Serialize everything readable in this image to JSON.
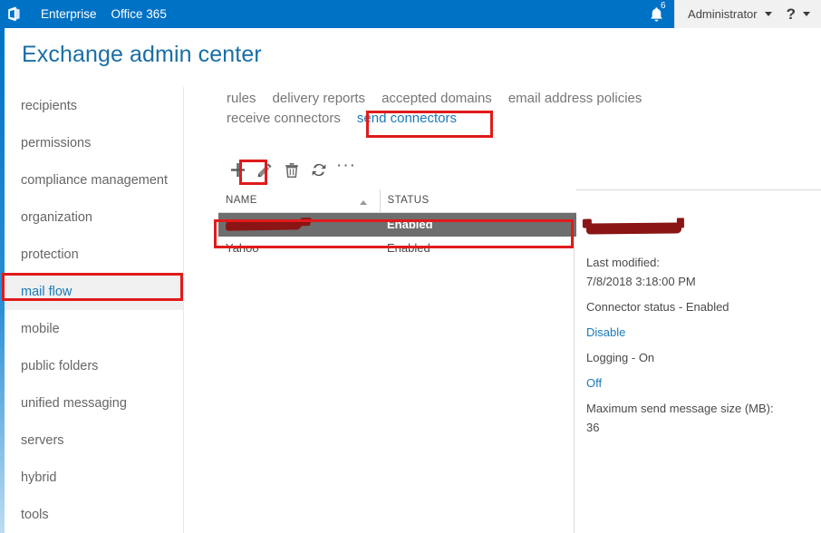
{
  "suite_bar": {
    "logo_icon": "office-logo-icon",
    "links": [
      {
        "label": "Enterprise"
      },
      {
        "label": "Office 365"
      }
    ],
    "notifications": {
      "icon": "bell-icon",
      "count": "6"
    },
    "account": {
      "name": "Administrator",
      "chevron_icon": "chevron-down-icon"
    },
    "help": {
      "label": "?",
      "chevron_icon": "chevron-down-icon"
    }
  },
  "page": {
    "title": "Exchange admin center"
  },
  "sidebar": {
    "items": [
      {
        "label": "recipients",
        "selected": false
      },
      {
        "label": "permissions",
        "selected": false
      },
      {
        "label": "compliance management",
        "selected": false
      },
      {
        "label": "organization",
        "selected": false
      },
      {
        "label": "protection",
        "selected": false
      },
      {
        "label": "mail flow",
        "selected": true
      },
      {
        "label": "mobile",
        "selected": false
      },
      {
        "label": "public folders",
        "selected": false
      },
      {
        "label": "unified messaging",
        "selected": false
      },
      {
        "label": "servers",
        "selected": false
      },
      {
        "label": "hybrid",
        "selected": false
      },
      {
        "label": "tools",
        "selected": false
      }
    ]
  },
  "tabs": [
    {
      "label": "rules",
      "active": false
    },
    {
      "label": "delivery reports",
      "active": false
    },
    {
      "label": "accepted domains",
      "active": false
    },
    {
      "label": "email address policies",
      "active": false
    },
    {
      "label": "receive connectors",
      "active": false
    },
    {
      "label": "send connectors",
      "active": true
    }
  ],
  "toolbar": {
    "buttons": [
      {
        "name": "add-button",
        "icon": "plus-icon"
      },
      {
        "name": "edit-button",
        "icon": "pencil-icon"
      },
      {
        "name": "delete-button",
        "icon": "trash-icon"
      },
      {
        "name": "refresh-button",
        "icon": "refresh-icon"
      },
      {
        "name": "more-button",
        "icon": "ellipsis-icon",
        "label": "···"
      }
    ]
  },
  "table": {
    "columns": [
      {
        "label": "NAME",
        "sorted": "asc"
      },
      {
        "label": "STATUS",
        "sorted": "none"
      }
    ],
    "rows": [
      {
        "name": "",
        "name_redacted": true,
        "status": "Enabled",
        "selected": true
      },
      {
        "name": "Yahoo",
        "name_redacted": false,
        "status": "Enabled",
        "selected": false
      }
    ]
  },
  "details": {
    "title_redacted": true,
    "last_modified_label": "Last modified:",
    "last_modified_value": "7/8/2018 3:18:00 PM",
    "connector_status": "Connector status - Enabled",
    "disable_link": "Disable",
    "logging_status": "Logging - On",
    "off_link": "Off",
    "max_size_label": "Maximum send message size (MB):",
    "max_size_value": "36"
  },
  "annotations": {
    "accent": "#e01b1b",
    "boxes": [
      {
        "name": "annotation-mail-flow"
      },
      {
        "name": "annotation-send-connectors"
      },
      {
        "name": "annotation-edit-button"
      },
      {
        "name": "annotation-selected-row"
      }
    ]
  },
  "colors": {
    "suite_bar": "#0072c6",
    "title": "#1a6ea5",
    "link": "#1a7bb9",
    "selected_row": "#6e6e6e",
    "redaction": "#8b1414"
  }
}
